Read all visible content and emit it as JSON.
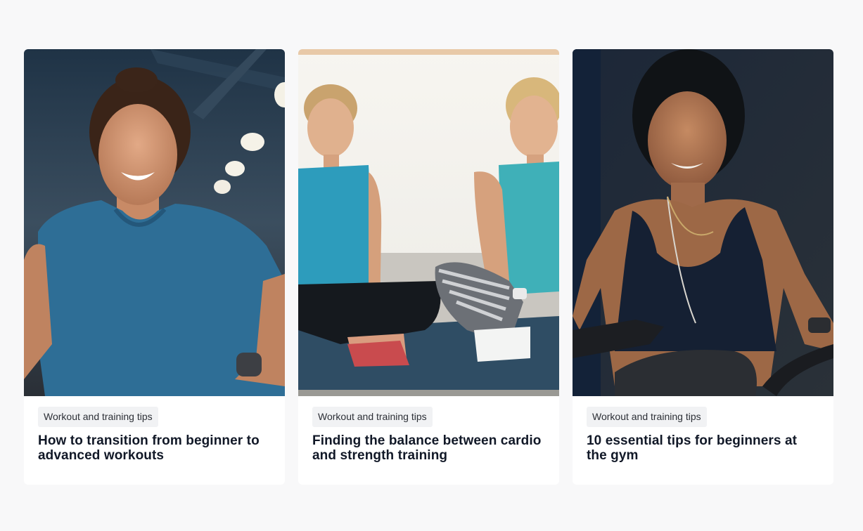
{
  "articles": [
    {
      "category": "Workout and training tips",
      "title": "How to transition from beginner to advanced workouts",
      "image_alt": "Smiling woman in blue t-shirt with hands on hips in a gym"
    },
    {
      "category": "Workout and training tips",
      "title": "Finding the balance between cardio and strength training",
      "image_alt": "Two women in teal tank tops sitting cross-legged on a yoga mat"
    },
    {
      "category": "Workout and training tips",
      "title": "10 essential tips for beginners at the gym",
      "image_alt": "Woman in dark tank top riding an exercise bike"
    }
  ]
}
